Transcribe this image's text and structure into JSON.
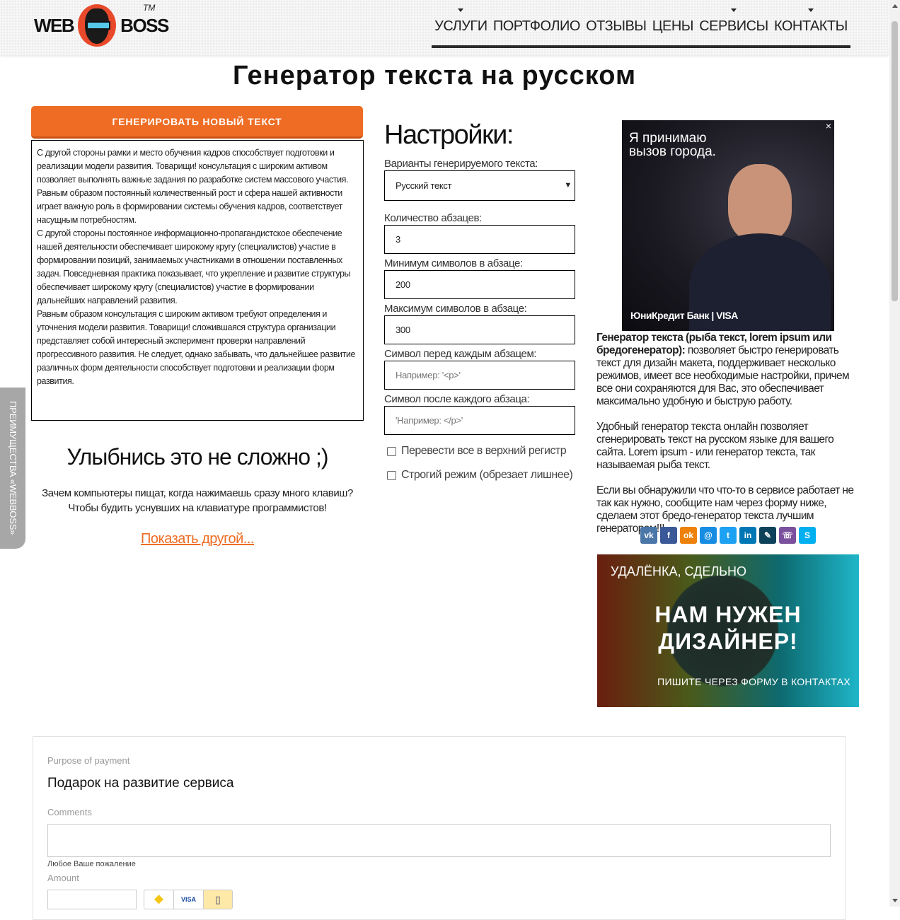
{
  "header": {
    "logo_left": "WEB",
    "logo_right": "BOSS",
    "logo_tm": "TM",
    "nav": [
      {
        "label": "УСЛУГИ",
        "dropdown": true
      },
      {
        "label": "ПОРТФОЛИО",
        "dropdown": false
      },
      {
        "label": "ОТЗЫВЫ",
        "dropdown": false
      },
      {
        "label": "ЦЕНЫ",
        "dropdown": false
      },
      {
        "label": "СЕРВИСЫ",
        "dropdown": true
      },
      {
        "label": "КОНТАКТЫ",
        "dropdown": true
      }
    ]
  },
  "page_title": "Генератор текста на русском",
  "generator": {
    "button": "ГЕНЕРИРОВАТЬ НОВЫЙ ТЕКСТ",
    "paragraphs": [
      "С другой стороны рамки и место обучения кадров способствует подготовки и реализации модели развития. Товарищи! консультация с широким активом позволяет выполнять важные задания по разработке систем массового участия. Равным образом постоянный количественный рост и сфера нашей активности играет важную роль в формировании системы обучения кадров, соответствует насущным потребностям.",
      "С другой стороны постоянное информационно-пропагандистское обеспечение нашей деятельности обеспечивает широкому кругу (специалистов) участие в формировании позиций, занимаемых участниками в отношении поставленных задач. Повседневная практика показывает, что укрепление и развитие структуры обеспечивает широкому кругу (специалистов) участие в формировании дальнейших направлений развития.",
      "Равным образом консультация с широким активом требуют определения и уточнения модели развития. Товарищи! сложившаяся структура организации представляет собой интересный эксперимент проверки направлений прогрессивного развития. Не следует, однако забывать, что дальнейшее развитие различных форм деятельности способствует подготовки и реализации форм развития."
    ]
  },
  "joke": {
    "title": "Улыбнись это не сложно ;)",
    "text": "Зачем компьютеры пищат, когда нажимаешь сразу много клавиш? Чтобы будить уснувших на клавиатуре программистов!",
    "link": "Показать другой..."
  },
  "settings": {
    "title": "Настройки:",
    "variant_label": "Варианты генерируемого текста:",
    "variant_value": "Русский текст",
    "paragraphs_label": "Количество абзацев:",
    "paragraphs_value": "3",
    "min_label": "Минимум символов в абзаце:",
    "min_value": "200",
    "max_label": "Максимум символов в абзаце:",
    "max_value": "300",
    "before_label": "Символ перед каждым абзацем:",
    "before_placeholder": "Например: '<p>'",
    "after_label": "Символ после каждого абзаца:",
    "after_placeholder": "'Например: </p>'",
    "uppercase_label": "Перевести все в верхний регистр",
    "uppercase_checked": false,
    "strict_label": "Строгий режим (обрезает лишнее)",
    "strict_checked": false
  },
  "ad_top": {
    "text": "Я принимаю вызов города.",
    "brand": "ЮниКредит Банк | VISA",
    "close": "×"
  },
  "about": {
    "bold": "Генератор текста (рыба текст, lorem ipsum или бредогенератор):",
    "p1": " позволяет быстро генерировать текст для дизайн макета, поддерживает несколько режимов, имеет все необходимые настройки, причем все они сохраняются для Вас, это обеспечивает максимально удобную и быструю работу.",
    "p2": "Удобный генератор текста онлайн позволяет сгенерировать текст на русском языке для вашего сайта. Lorem ipsum - или генератор текста, так называемая рыба текст.",
    "p3": "Если вы обнаружили что что-то в сервисе работает не так как нужно, сообщите нам через форму ниже, сделаем этот бредо-генератор текста лучшим генератором!!!"
  },
  "social": [
    {
      "name": "vk",
      "glyph": "vk",
      "color": "#4a76a8"
    },
    {
      "name": "facebook",
      "glyph": "f",
      "color": "#3b5998"
    },
    {
      "name": "odnoklassniki",
      "glyph": "ok",
      "color": "#ee8208"
    },
    {
      "name": "moimir",
      "glyph": "@",
      "color": "#168de2"
    },
    {
      "name": "twitter",
      "glyph": "t",
      "color": "#1da1f2"
    },
    {
      "name": "linkedin",
      "glyph": "in",
      "color": "#0077b5"
    },
    {
      "name": "livejournal",
      "glyph": "✎",
      "color": "#0d425a"
    },
    {
      "name": "viber",
      "glyph": "☏",
      "color": "#7b519d"
    },
    {
      "name": "skype",
      "glyph": "S",
      "color": "#00aff0"
    }
  ],
  "ad_bottom": {
    "line1": "УДАЛЁНКА, СДЕЛЬНО",
    "line2": "НАМ НУЖЕН",
    "line3": "ДИЗАЙНЕР!",
    "line4": "ПИШИТЕ ЧЕРЕЗ ФОРМУ В КОНТАКТАХ"
  },
  "payment": {
    "purpose_label": "Purpose of payment",
    "purpose_value": "Подарок на развитие сервиса",
    "comments_label": "Comments",
    "comments_hint": "Любое Ваше пожаление",
    "amount_label": "Amount",
    "amount_value": "",
    "methods": [
      "yoomoney-wallet",
      "VISA",
      "mobile"
    ]
  },
  "side_tab": "ПРЕИМУЩЕСТВА «WEBBOSS»"
}
